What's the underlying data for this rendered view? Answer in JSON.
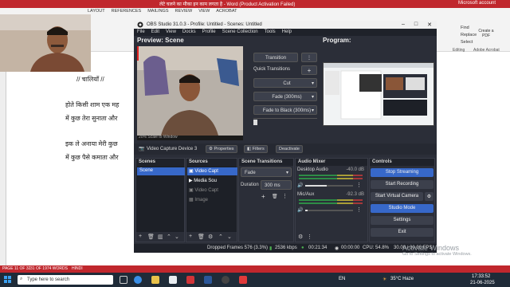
{
  "word": {
    "title": "लेटे चलने का मौका इन काम लगता है - Word (Product Activation Failed)",
    "account": "Microsoft account",
    "tabs": [
      "LAYOUT",
      "REFERENCES",
      "MAILINGS",
      "REVIEW",
      "VIEW",
      "ACROBAT"
    ],
    "right_tools": [
      "Find",
      "Replace",
      "Select"
    ],
    "create_pdf": "Create a PDF",
    "groups": [
      "Editing",
      "Adobe Acrobat"
    ],
    "text_lines": [
      "// चालियाँ //",
      "होते किसी शाम एक मह",
      "में कुछ तेरा सुनाता और",
      "इक ले अनाया मेरी कुछ",
      "में कुछ पैसे कमाता और"
    ],
    "status": {
      "page": "PAGE 11 OF 32",
      "words": "31 OF 1974 WORDS",
      "lang": "HINDI"
    }
  },
  "taskbar": {
    "search_placeholder": "Type here to search",
    "weather": "35°C Haze",
    "lang": "EN",
    "time": "17:33:52",
    "date": "21-06-2025"
  },
  "obs": {
    "title": "OBS Studio 31.0.3 - Profile: Untitled - Scenes: Untitled",
    "menu": [
      "File",
      "Edit",
      "View",
      "Docks",
      "Profile",
      "Scene Collection",
      "Tools",
      "Help"
    ],
    "preview_label": "Preview: Scene",
    "program_label": "Program:",
    "transition_button": "Transition",
    "quick_transitions": "Quick Transitions",
    "quick_items": [
      "Cut",
      "Fade (300ms)",
      "Fade to Black (300ms)"
    ],
    "zoom_text": "20%  Scale to Window",
    "source_toolbar": {
      "source_name": "Video Capture Device 3",
      "properties": "Properties",
      "filters": "Filters",
      "deactivate": "Deactivate"
    },
    "docks": {
      "scenes": {
        "title": "Scenes",
        "items": [
          "Scene"
        ]
      },
      "sources": {
        "title": "Sources",
        "items": [
          "Video Capt",
          "Media Sou",
          "Video Capt",
          "Image"
        ]
      },
      "transitions": {
        "title": "Scene Transitions",
        "type": "Fade",
        "duration_label": "Duration",
        "duration_value": "300 ms"
      },
      "mixer": {
        "title": "Audio Mixer",
        "channels": [
          {
            "name": "Desktop Audio",
            "db": "-40.0 dB",
            "level": 0.45
          },
          {
            "name": "Mic/Aux",
            "db": "-92.3 dB",
            "level": 0.05
          }
        ]
      },
      "controls": {
        "title": "Controls",
        "buttons": [
          "Stop Streaming",
          "Start Recording",
          "Start Virtual Camera",
          "Studio Mode",
          "Settings",
          "Exit"
        ]
      }
    },
    "status": {
      "dropped": "Dropped Frames 576 (3.3%)",
      "bitrate": "2536 kbps",
      "stream_time": "00:21:34",
      "rec_time": "00:00:00",
      "cpu": "CPU: 54.8%",
      "fps": "30.00 / 30.00 FPS"
    },
    "colors": {
      "accent": "#3768c9",
      "bg": "#2b2e38"
    }
  },
  "watermark": {
    "line1": "Activate Windows",
    "line2": "Go to Settings to activate Windows."
  }
}
